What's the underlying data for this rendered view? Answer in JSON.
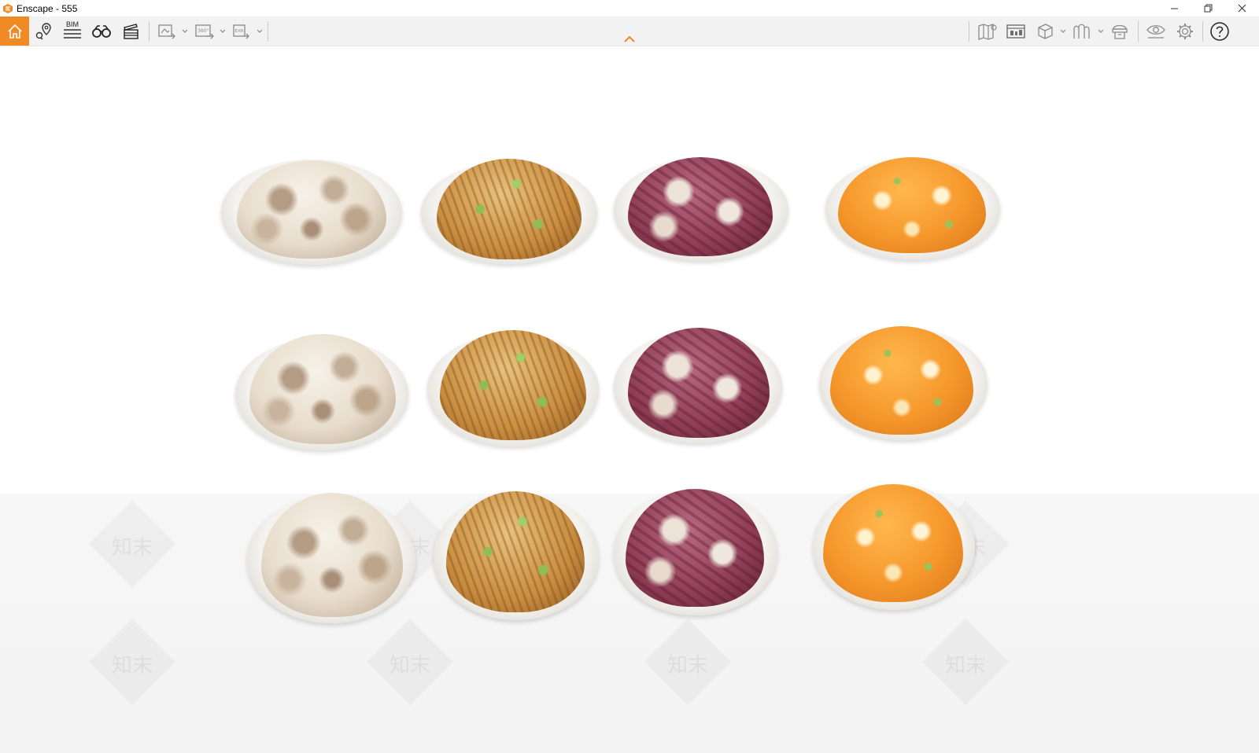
{
  "window": {
    "title": "Enscape - 555",
    "controls": [
      "minimize-icon",
      "restore-icon",
      "close-icon"
    ]
  },
  "toolbar": {
    "accent_color": "#f08a24",
    "bim_label": "BIM",
    "left_tools": [
      "home-icon",
      "location-pin-icon",
      "bim-list-icon",
      "binoculars-icon",
      "clapperboard-icon"
    ],
    "export_tools": [
      "screenshot-export-icon",
      "panorama-360-export-icon",
      "exr-export-icon"
    ],
    "pano_label": "360°",
    "exr_label": "EXR",
    "right_tools": [
      "map-icon",
      "site-context-icon",
      "cube-view-icon",
      "atmosphere-icon",
      "asset-library-icon",
      "visual-settings-icon",
      "settings-gear-icon",
      "help-icon"
    ]
  },
  "scene": {
    "watermark_text": "知末",
    "plate_rows": 3,
    "plate_columns": 4,
    "dish_types": [
      "white-noodles",
      "fried-rice",
      "meat-slices",
      "orange-curry"
    ]
  }
}
